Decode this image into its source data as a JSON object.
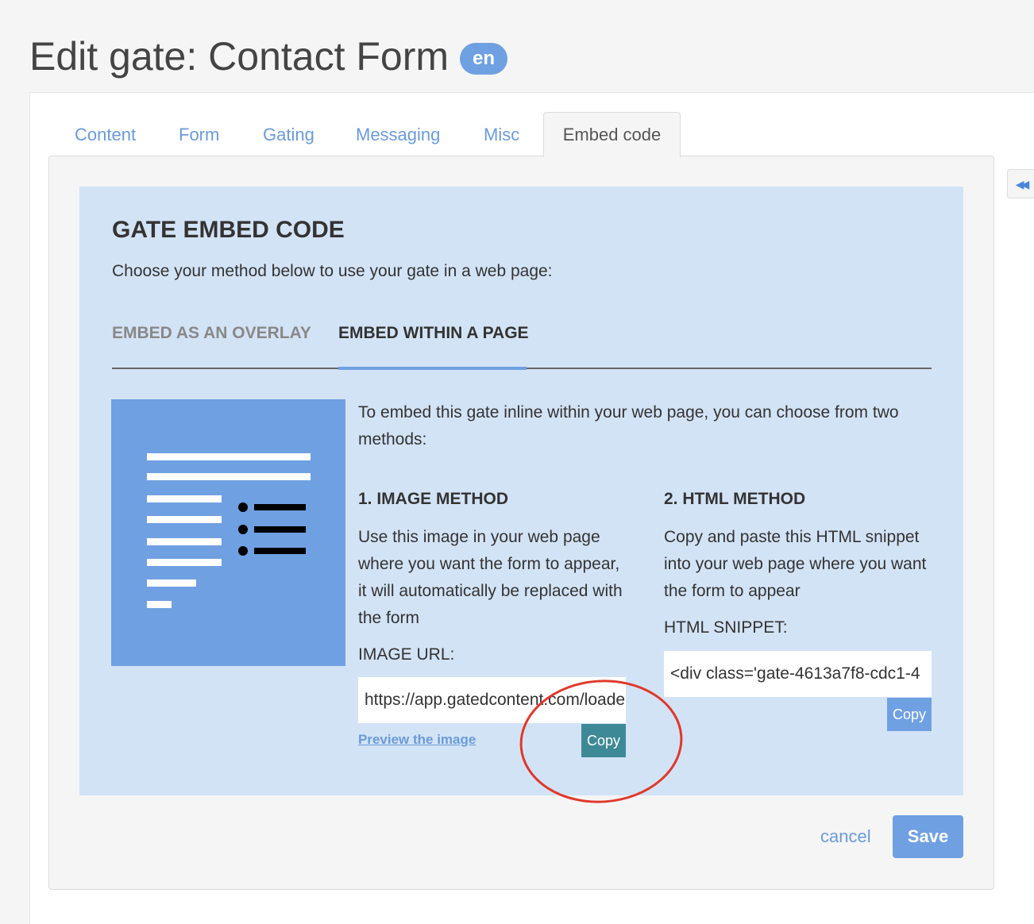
{
  "page": {
    "title": "Edit gate: Contact Form",
    "language_badge": "en"
  },
  "tabs": [
    {
      "label": "Content",
      "active": false
    },
    {
      "label": "Form",
      "active": false
    },
    {
      "label": "Gating",
      "active": false
    },
    {
      "label": "Messaging",
      "active": false
    },
    {
      "label": "Misc",
      "active": false
    },
    {
      "label": "Embed code",
      "active": true
    }
  ],
  "side_toggle": {
    "icon": "double-chevron-left-icon",
    "glyph": "◀◀"
  },
  "embed": {
    "title": "GATE EMBED CODE",
    "subtitle": "Choose your method below to use your gate in a web page:",
    "sub_tabs": [
      {
        "label": "EMBED AS AN OVERLAY",
        "active": false
      },
      {
        "label": "EMBED WITHIN A PAGE",
        "active": true
      }
    ],
    "intro": "To embed this gate inline within your web page, you can choose from two methods:",
    "image_method": {
      "heading": "1. IMAGE METHOD",
      "description": "Use this image in your web page where you want the form to appear, it will automatically be replaced with the form",
      "field_label": "IMAGE URL:",
      "value": "https://app.gatedcontent.com/loader",
      "copy_label": "Copy",
      "preview_link": "Preview the image"
    },
    "html_method": {
      "heading": "2. HTML METHOD",
      "description": "Copy and paste this HTML snippet into your web page where you want the form to appear",
      "field_label": "HTML SNIPPET:",
      "value": "<div class='gate-4613a7f8-cdc1-4",
      "copy_label": "Copy"
    }
  },
  "footer": {
    "cancel_label": "cancel",
    "save_label": "Save"
  },
  "colors": {
    "accent": "#6fa0e2",
    "link": "#6b9bd8",
    "teal_button": "#3d8a96",
    "embed_background": "#d3e3f6",
    "annotation": "#e0392b"
  }
}
